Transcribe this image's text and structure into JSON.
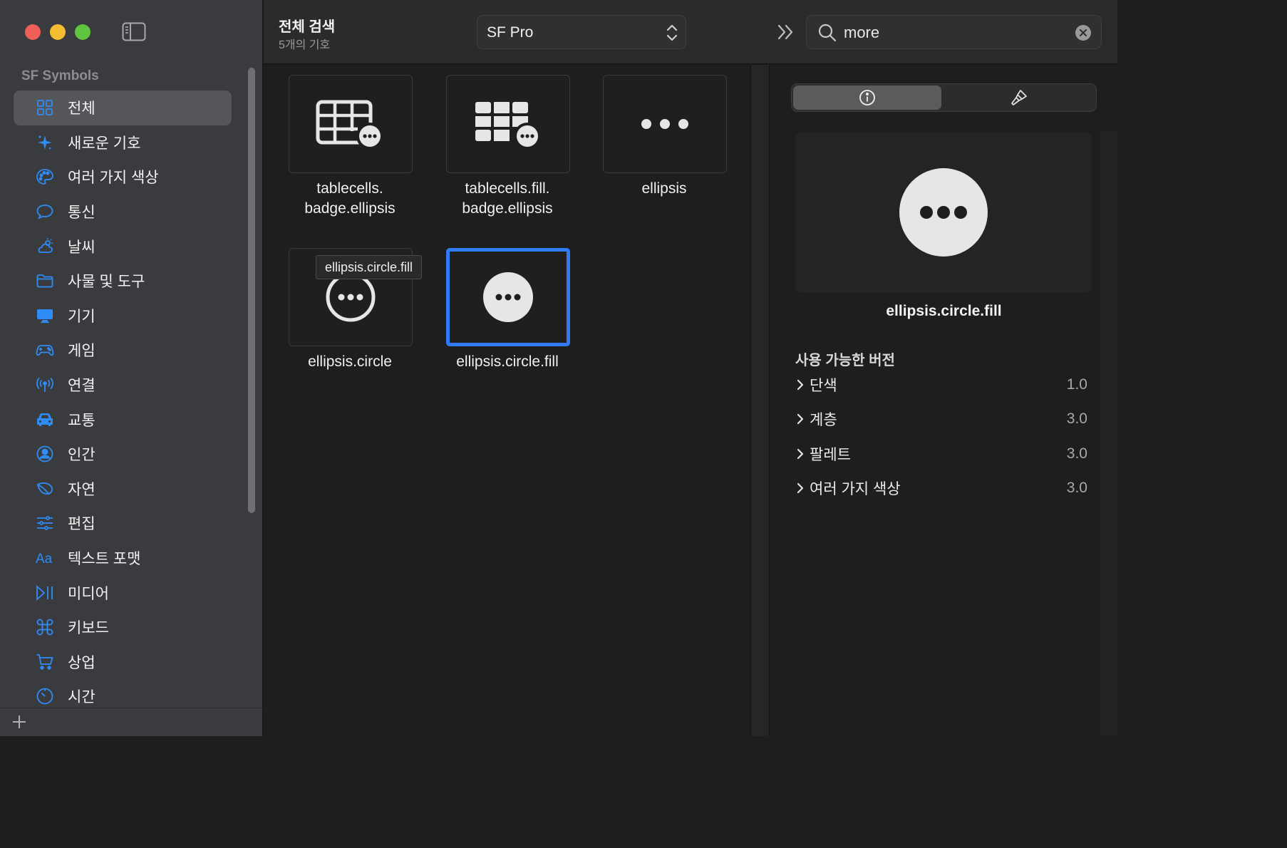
{
  "sidebar": {
    "section_title": "SF Symbols",
    "items": [
      {
        "label": "전체",
        "icon": "grid-icon",
        "active": true
      },
      {
        "label": "새로운 기호",
        "icon": "sparkle-icon"
      },
      {
        "label": "여러 가지 색상",
        "icon": "palette-icon"
      },
      {
        "label": "통신",
        "icon": "message-bubble-icon"
      },
      {
        "label": "날씨",
        "icon": "cloud-sun-icon"
      },
      {
        "label": "사물 및 도구",
        "icon": "folder-icon"
      },
      {
        "label": "기기",
        "icon": "desktop-icon"
      },
      {
        "label": "게임",
        "icon": "gamecontroller-icon"
      },
      {
        "label": "연결",
        "icon": "antenna-icon"
      },
      {
        "label": "교통",
        "icon": "car-icon"
      },
      {
        "label": "인간",
        "icon": "person-circle-icon"
      },
      {
        "label": "자연",
        "icon": "leaf-icon"
      },
      {
        "label": "편집",
        "icon": "sliders-icon"
      },
      {
        "label": "텍스트 포맷",
        "icon": "textformat-icon"
      },
      {
        "label": "미디어",
        "icon": "play-pause-icon"
      },
      {
        "label": "키보드",
        "icon": "command-icon"
      },
      {
        "label": "상업",
        "icon": "cart-icon"
      },
      {
        "label": "시간",
        "icon": "timer-icon"
      }
    ]
  },
  "toolbar": {
    "title": "전체 검색",
    "subtitle": "5개의 기호",
    "font_select": "SF Pro",
    "search_value": "more"
  },
  "grid": {
    "symbols": [
      {
        "label": "tablecells.\nbadge.ellipsis",
        "line1": "tablecells.",
        "line2": "badge.ellipsis",
        "icon": "tablecells-badge-ellipsis-icon"
      },
      {
        "label": "tablecells.fill.\nbadge.ellipsis",
        "line1": "tablecells.fill.",
        "line2": "badge.ellipsis",
        "icon": "tablecells-fill-badge-ellipsis-icon"
      },
      {
        "label": "ellipsis",
        "line1": "ellipsis",
        "line2": "",
        "icon": "ellipsis-icon"
      },
      {
        "label": "ellipsis.circle",
        "line1": "ellipsis.circle",
        "line2": "",
        "icon": "ellipsis-circle-icon"
      },
      {
        "label": "ellipsis.circle.fill",
        "line1": "ellipsis.circle.fill",
        "line2": "",
        "icon": "ellipsis-circle-fill-icon",
        "selected": true
      }
    ],
    "tooltip": "ellipsis.circle.fill"
  },
  "inspector": {
    "symbol_name": "ellipsis.circle.fill",
    "versions_heading": "사용 가능한 버전",
    "versions": [
      {
        "label": "단색",
        "value": "1.0"
      },
      {
        "label": "계층",
        "value": "3.0"
      },
      {
        "label": "팔레트",
        "value": "3.0"
      },
      {
        "label": "여러 가지 색상",
        "value": "3.0"
      }
    ]
  },
  "colors": {
    "accent": "#2f7cf6",
    "sidebar_icon": "#2f8cf5",
    "sidebar_bg": "#3a3b3f"
  }
}
